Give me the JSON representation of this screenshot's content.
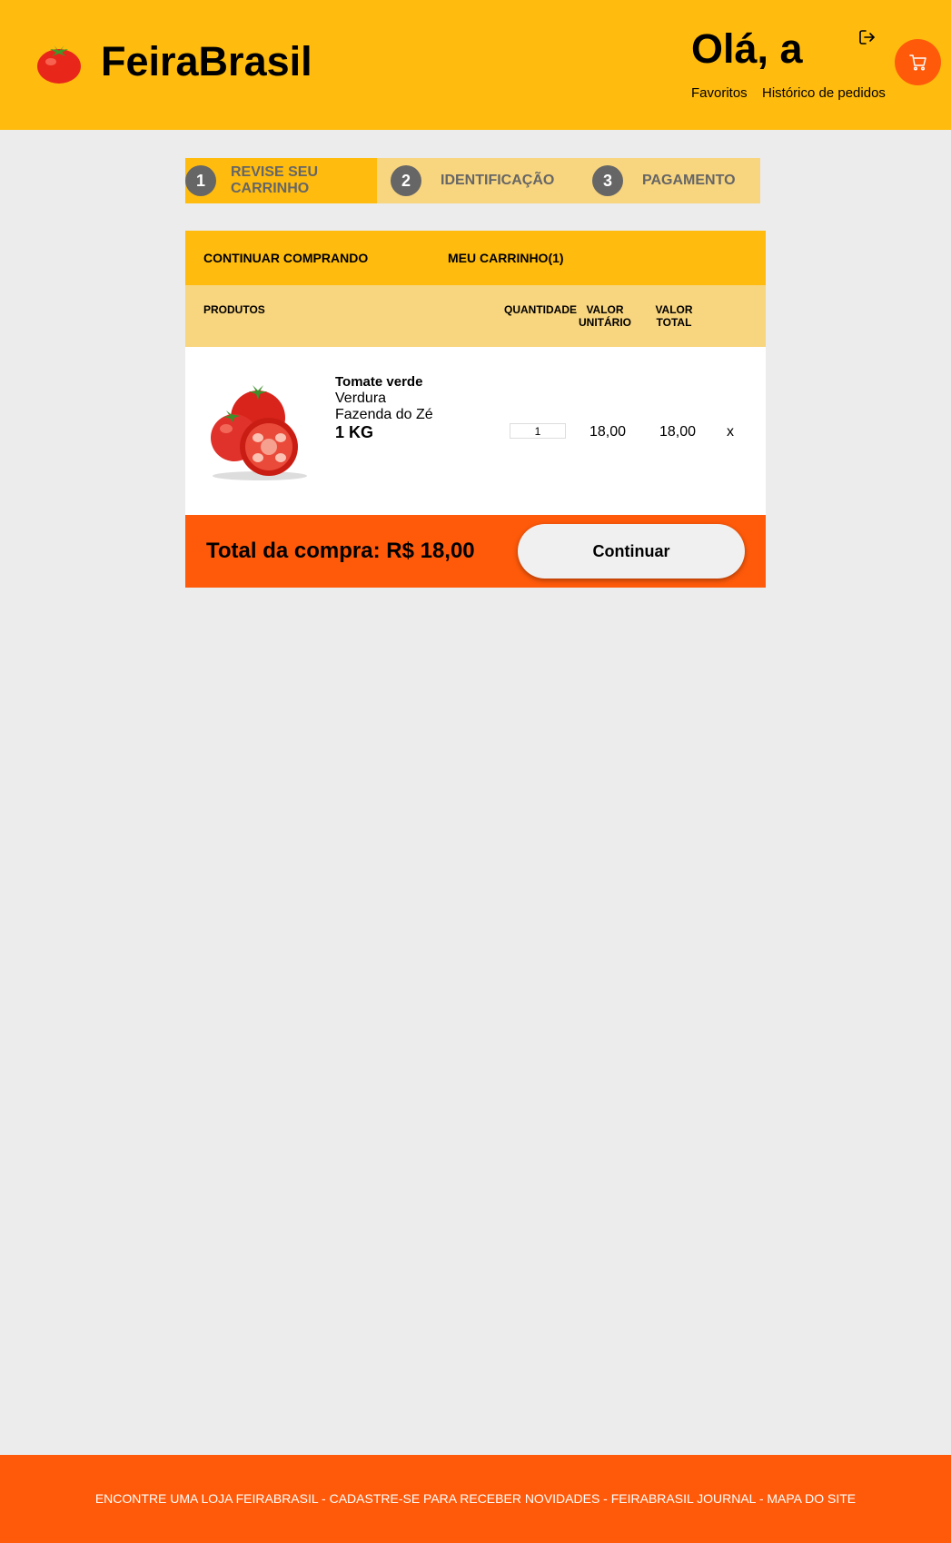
{
  "header": {
    "brand": "FeiraBrasil",
    "greeting": "Olá, a",
    "links": {
      "favorites": "Favoritos",
      "order_history": "Histórico de pedidos"
    },
    "icons": {
      "logo": "tomato-icon",
      "logout": "logout-icon",
      "cart": "cart-icon"
    }
  },
  "steps": [
    {
      "number": "1",
      "label": "REVISE SEU CARRINHO",
      "active": true
    },
    {
      "number": "2",
      "label": "IDENTIFICAÇÃO",
      "active": false
    },
    {
      "number": "3",
      "label": "PAGAMENTO",
      "active": false
    }
  ],
  "cart": {
    "continue_shopping": "CONTINUAR COMPRANDO",
    "my_cart": "MEU CARRINHO(1)",
    "columns": {
      "products": "PRODUTOS",
      "quantity": "QUANTIDADE",
      "unit_value": "VALOR UNITÁRIO",
      "total_value": "VALOR TOTAL"
    },
    "items": [
      {
        "name": "Tomate verde",
        "category": "Verdura",
        "farm": "Fazenda do Zé",
        "unit": "1 KG",
        "quantity": "1",
        "unit_value": "18,00",
        "total_value": "18,00",
        "remove": "x"
      }
    ],
    "total_label": "Total da compra: R$ 18,00",
    "continue_button": "Continuar"
  },
  "footer": {
    "text": "ENCONTRE UMA LOJA FEIRABRASIL - CADASTRE-SE PARA RECEBER NOVIDADES - FEIRABRASIL JOURNAL - MAPA DO SITE"
  },
  "colors": {
    "header_bg": "#ffbc0f",
    "step_bar_bg": "#f8d57f",
    "accent_orange": "#ff5a0a",
    "page_bg": "#ececec"
  }
}
